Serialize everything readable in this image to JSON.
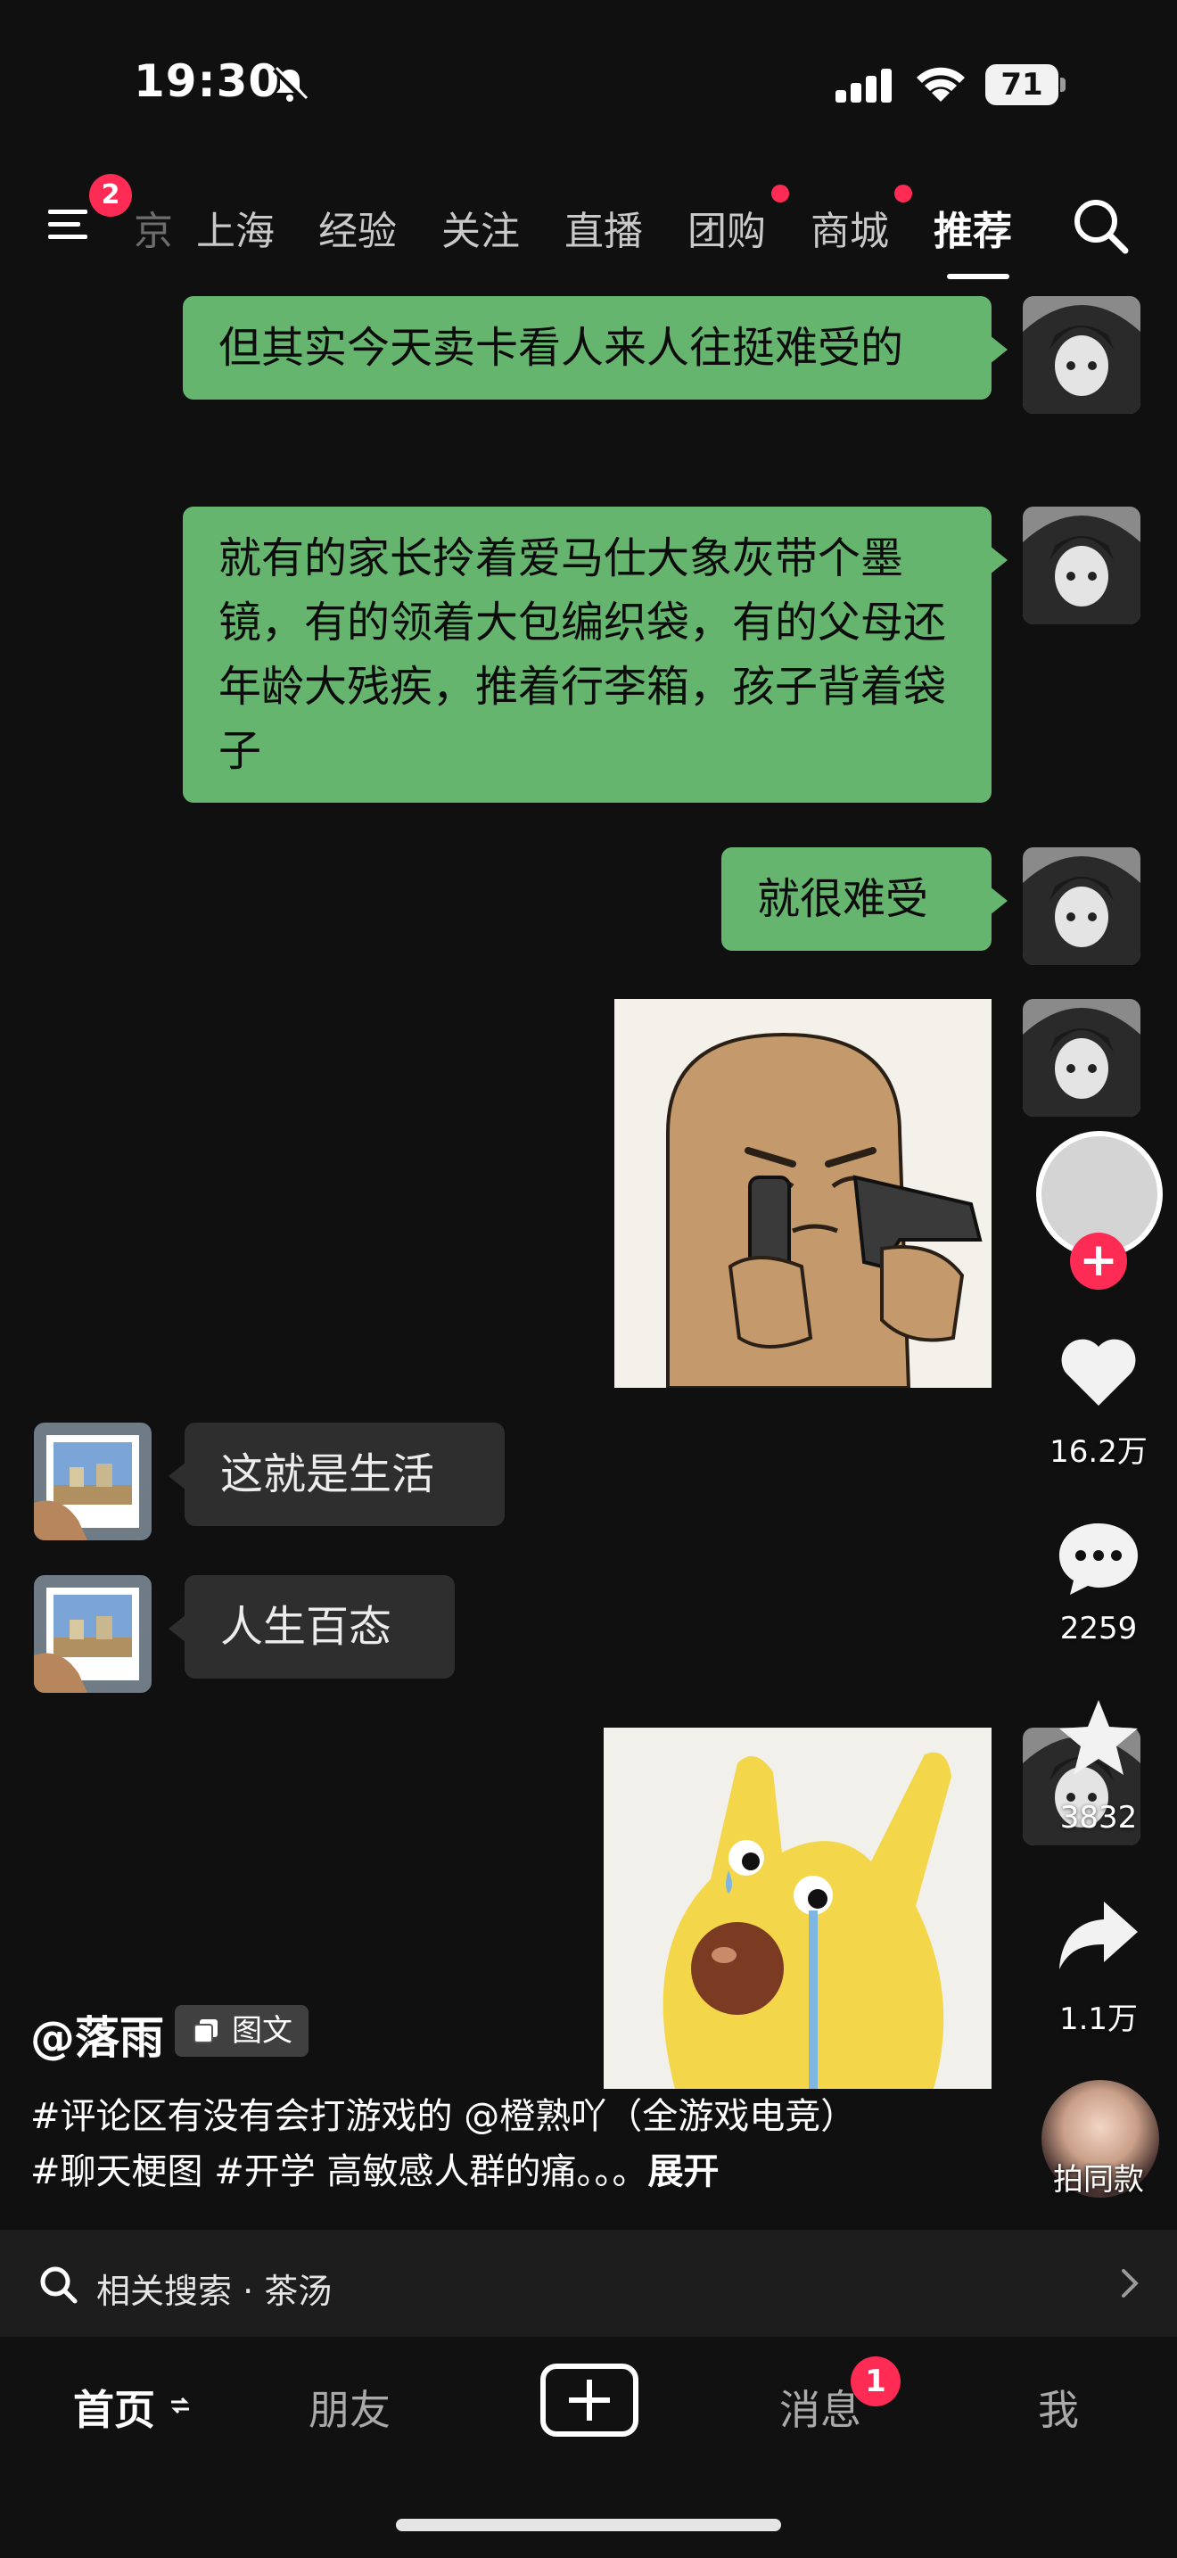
{
  "status": {
    "time": "19:30",
    "battery": "71"
  },
  "top_nav": {
    "menu_badge": "2",
    "tabs": [
      {
        "label": "京",
        "dot": false
      },
      {
        "label": "上海",
        "dot": false
      },
      {
        "label": "经验",
        "dot": false
      },
      {
        "label": "关注",
        "dot": false
      },
      {
        "label": "直播",
        "dot": false
      },
      {
        "label": "团购",
        "dot": true
      },
      {
        "label": "商城",
        "dot": true
      },
      {
        "label": "推荐",
        "dot": false,
        "active": true
      }
    ]
  },
  "chat": {
    "messages": [
      {
        "side": "right",
        "text": "但其实今天卖卡看人来人往挺难受的"
      },
      {
        "side": "right",
        "text": "就有的家长拎着爱马仕大象灰带个墨镜，有的领着大包编织袋，有的父母还年龄大残疾，推着行李箱，孩子背着袋子"
      },
      {
        "side": "right",
        "text": "就很难受"
      },
      {
        "side": "right",
        "sticker": "gun-meme"
      },
      {
        "side": "left",
        "text": "这就是生活"
      },
      {
        "side": "left",
        "text": "人生百态"
      },
      {
        "side": "right",
        "sticker": "crying-dog"
      }
    ]
  },
  "actions": {
    "likes": "16.2万",
    "comments": "2259",
    "favorites": "3832",
    "shares": "1.1万",
    "music_label": "拍同款"
  },
  "post": {
    "author": "@落雨",
    "type_badge": "图文",
    "description_line1": "#评论区有没有会打游戏的 @橙熟吖（全游戏电竞）",
    "description_line2": "#聊天梗图 #开学 高敏感人群的痛。。。",
    "expand": "展开"
  },
  "related_search": {
    "label": "相关搜索 · 茶汤"
  },
  "bottom_nav": {
    "home": "首页",
    "friends": "朋友",
    "messages": "消息",
    "messages_badge": "1",
    "me": "我"
  },
  "colors": {
    "accent": "#fe2c55",
    "bubble_green": "#66b56f",
    "bubble_grey": "#2e2e2e",
    "background": "#101010"
  }
}
